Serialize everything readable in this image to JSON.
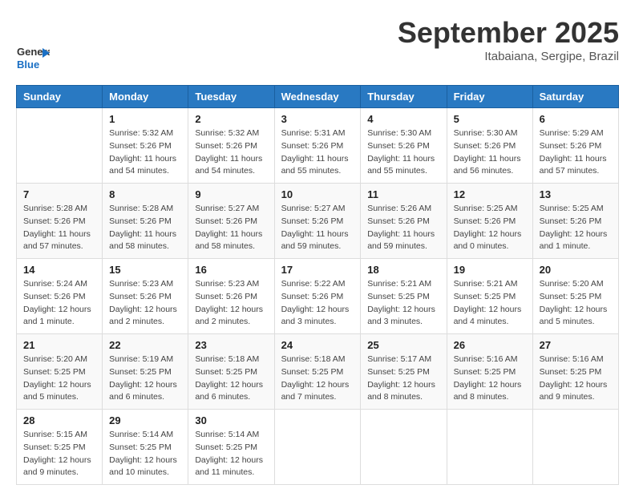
{
  "header": {
    "logo_general": "General",
    "logo_blue": "Blue",
    "month_title": "September 2025",
    "location": "Itabaiana, Sergipe, Brazil"
  },
  "weekdays": [
    "Sunday",
    "Monday",
    "Tuesday",
    "Wednesday",
    "Thursday",
    "Friday",
    "Saturday"
  ],
  "weeks": [
    [
      {
        "day": "",
        "text": ""
      },
      {
        "day": "1",
        "text": "Sunrise: 5:32 AM\nSunset: 5:26 PM\nDaylight: 11 hours\nand 54 minutes."
      },
      {
        "day": "2",
        "text": "Sunrise: 5:32 AM\nSunset: 5:26 PM\nDaylight: 11 hours\nand 54 minutes."
      },
      {
        "day": "3",
        "text": "Sunrise: 5:31 AM\nSunset: 5:26 PM\nDaylight: 11 hours\nand 55 minutes."
      },
      {
        "day": "4",
        "text": "Sunrise: 5:30 AM\nSunset: 5:26 PM\nDaylight: 11 hours\nand 55 minutes."
      },
      {
        "day": "5",
        "text": "Sunrise: 5:30 AM\nSunset: 5:26 PM\nDaylight: 11 hours\nand 56 minutes."
      },
      {
        "day": "6",
        "text": "Sunrise: 5:29 AM\nSunset: 5:26 PM\nDaylight: 11 hours\nand 57 minutes."
      }
    ],
    [
      {
        "day": "7",
        "text": "Sunrise: 5:28 AM\nSunset: 5:26 PM\nDaylight: 11 hours\nand 57 minutes."
      },
      {
        "day": "8",
        "text": "Sunrise: 5:28 AM\nSunset: 5:26 PM\nDaylight: 11 hours\nand 58 minutes."
      },
      {
        "day": "9",
        "text": "Sunrise: 5:27 AM\nSunset: 5:26 PM\nDaylight: 11 hours\nand 58 minutes."
      },
      {
        "day": "10",
        "text": "Sunrise: 5:27 AM\nSunset: 5:26 PM\nDaylight: 11 hours\nand 59 minutes."
      },
      {
        "day": "11",
        "text": "Sunrise: 5:26 AM\nSunset: 5:26 PM\nDaylight: 11 hours\nand 59 minutes."
      },
      {
        "day": "12",
        "text": "Sunrise: 5:25 AM\nSunset: 5:26 PM\nDaylight: 12 hours\nand 0 minutes."
      },
      {
        "day": "13",
        "text": "Sunrise: 5:25 AM\nSunset: 5:26 PM\nDaylight: 12 hours\nand 1 minute."
      }
    ],
    [
      {
        "day": "14",
        "text": "Sunrise: 5:24 AM\nSunset: 5:26 PM\nDaylight: 12 hours\nand 1 minute."
      },
      {
        "day": "15",
        "text": "Sunrise: 5:23 AM\nSunset: 5:26 PM\nDaylight: 12 hours\nand 2 minutes."
      },
      {
        "day": "16",
        "text": "Sunrise: 5:23 AM\nSunset: 5:26 PM\nDaylight: 12 hours\nand 2 minutes."
      },
      {
        "day": "17",
        "text": "Sunrise: 5:22 AM\nSunset: 5:26 PM\nDaylight: 12 hours\nand 3 minutes."
      },
      {
        "day": "18",
        "text": "Sunrise: 5:21 AM\nSunset: 5:25 PM\nDaylight: 12 hours\nand 3 minutes."
      },
      {
        "day": "19",
        "text": "Sunrise: 5:21 AM\nSunset: 5:25 PM\nDaylight: 12 hours\nand 4 minutes."
      },
      {
        "day": "20",
        "text": "Sunrise: 5:20 AM\nSunset: 5:25 PM\nDaylight: 12 hours\nand 5 minutes."
      }
    ],
    [
      {
        "day": "21",
        "text": "Sunrise: 5:20 AM\nSunset: 5:25 PM\nDaylight: 12 hours\nand 5 minutes."
      },
      {
        "day": "22",
        "text": "Sunrise: 5:19 AM\nSunset: 5:25 PM\nDaylight: 12 hours\nand 6 minutes."
      },
      {
        "day": "23",
        "text": "Sunrise: 5:18 AM\nSunset: 5:25 PM\nDaylight: 12 hours\nand 6 minutes."
      },
      {
        "day": "24",
        "text": "Sunrise: 5:18 AM\nSunset: 5:25 PM\nDaylight: 12 hours\nand 7 minutes."
      },
      {
        "day": "25",
        "text": "Sunrise: 5:17 AM\nSunset: 5:25 PM\nDaylight: 12 hours\nand 8 minutes."
      },
      {
        "day": "26",
        "text": "Sunrise: 5:16 AM\nSunset: 5:25 PM\nDaylight: 12 hours\nand 8 minutes."
      },
      {
        "day": "27",
        "text": "Sunrise: 5:16 AM\nSunset: 5:25 PM\nDaylight: 12 hours\nand 9 minutes."
      }
    ],
    [
      {
        "day": "28",
        "text": "Sunrise: 5:15 AM\nSunset: 5:25 PM\nDaylight: 12 hours\nand 9 minutes."
      },
      {
        "day": "29",
        "text": "Sunrise: 5:14 AM\nSunset: 5:25 PM\nDaylight: 12 hours\nand 10 minutes."
      },
      {
        "day": "30",
        "text": "Sunrise: 5:14 AM\nSunset: 5:25 PM\nDaylight: 12 hours\nand 11 minutes."
      },
      {
        "day": "",
        "text": ""
      },
      {
        "day": "",
        "text": ""
      },
      {
        "day": "",
        "text": ""
      },
      {
        "day": "",
        "text": ""
      }
    ]
  ]
}
